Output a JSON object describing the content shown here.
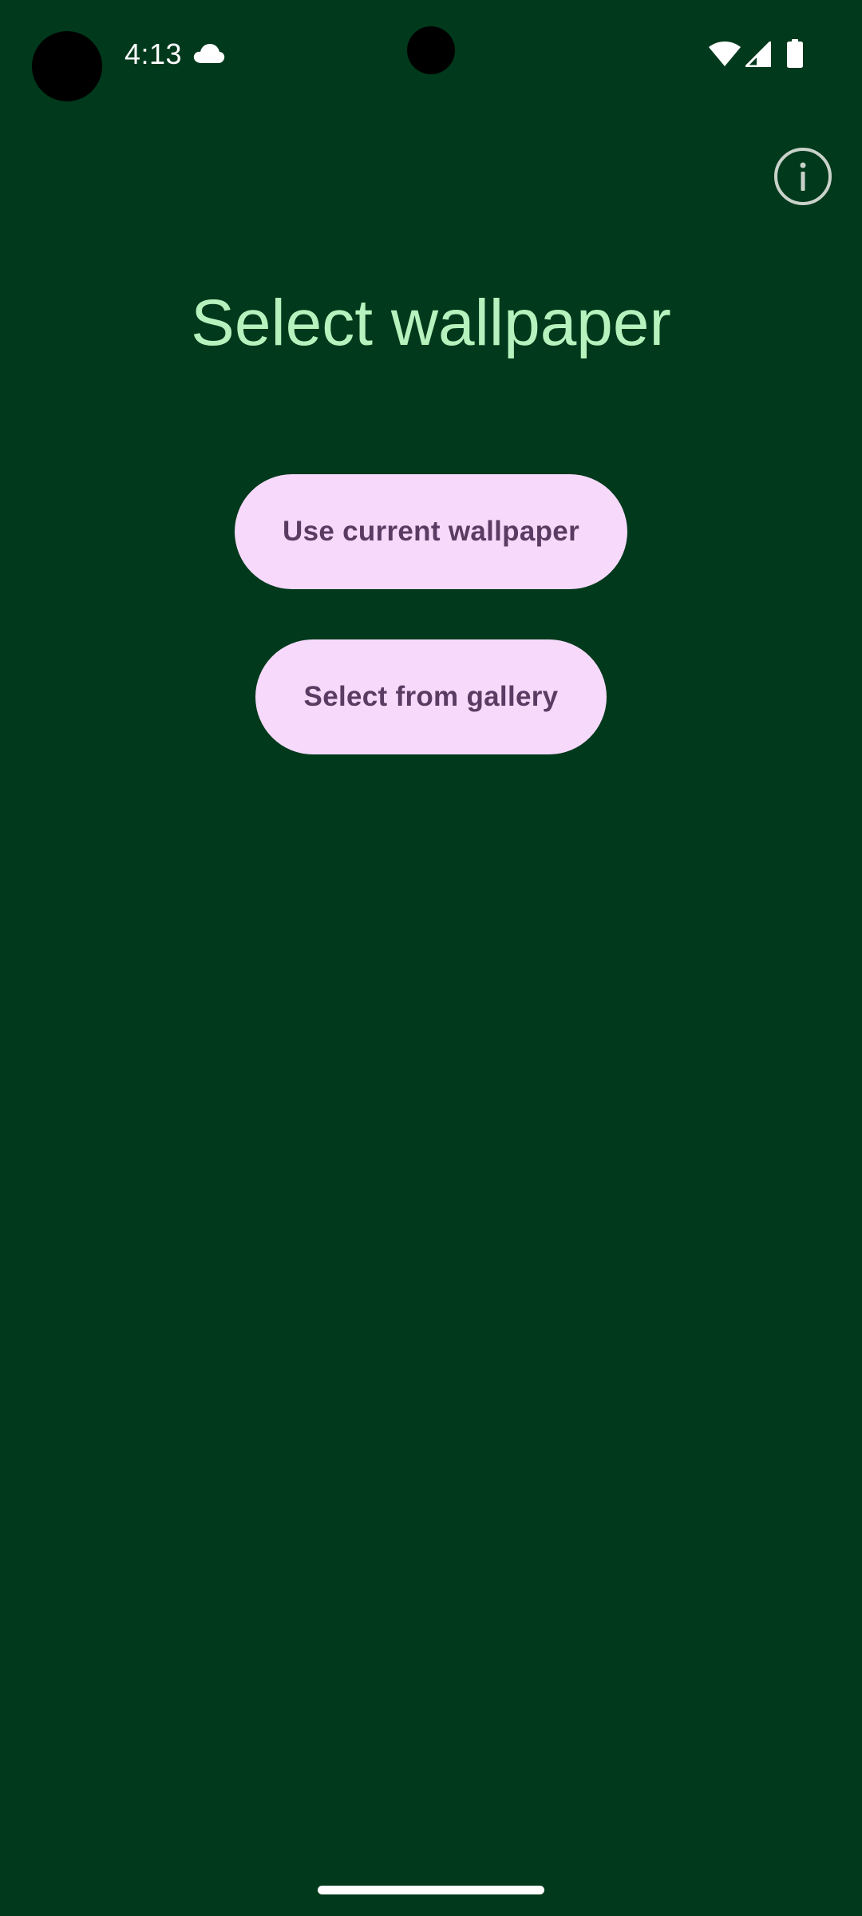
{
  "status_bar": {
    "time": "4:13",
    "icons": [
      "cloud-icon",
      "wifi-icon",
      "cellular-signal-icon",
      "battery-icon"
    ]
  },
  "header": {
    "info_icon": "info-circle-icon"
  },
  "main": {
    "title": "Select wallpaper",
    "buttons": {
      "use_current": "Use current wallpaper",
      "select_gallery": "Select from gallery"
    }
  },
  "colors": {
    "background": "#00391b",
    "title": "#b5f2bd",
    "button_bg": "#f6d9fb",
    "button_text": "#5c3b63"
  }
}
